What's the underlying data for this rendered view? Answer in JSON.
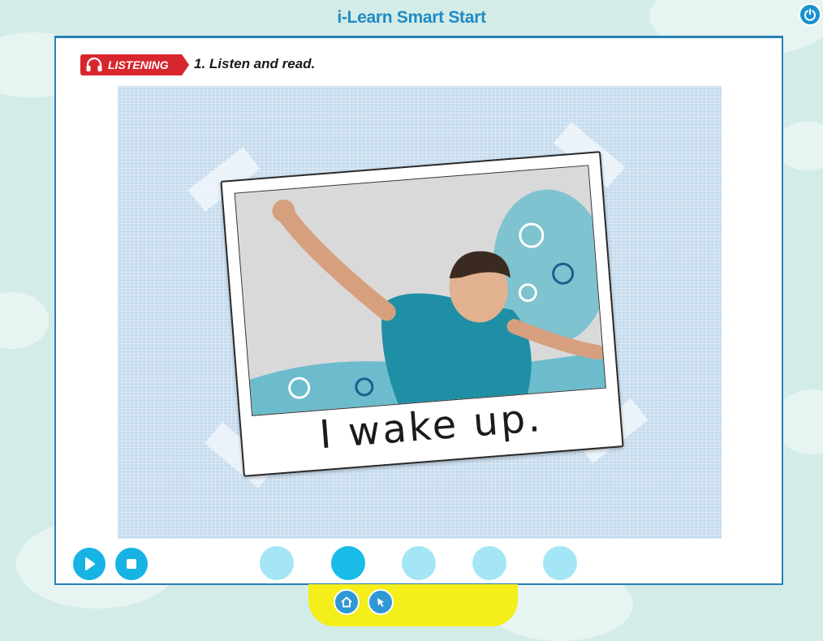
{
  "app": {
    "title": "i-Learn Smart Start"
  },
  "header": {
    "power_icon": "power-icon"
  },
  "activity": {
    "badge_label": "LISTENING",
    "badge_icon": "headphones-icon",
    "instruction": "1. Listen and read."
  },
  "slide": {
    "caption": "I wake up.",
    "photo_description_icon": "boy-stretching-photo"
  },
  "controls": {
    "play_icon": "play-icon",
    "stop_icon": "stop-icon",
    "slides_total": 5,
    "active_slide": 2
  },
  "nav": {
    "home_icon": "home-icon",
    "back_icon": "arrow-icon"
  },
  "colors": {
    "accent_blue": "#1f8ac4",
    "badge_red": "#d8262e",
    "control_cyan": "#16b3e4",
    "dot_inactive": "#a4e6f5",
    "tray_yellow": "#f4ee1a"
  }
}
